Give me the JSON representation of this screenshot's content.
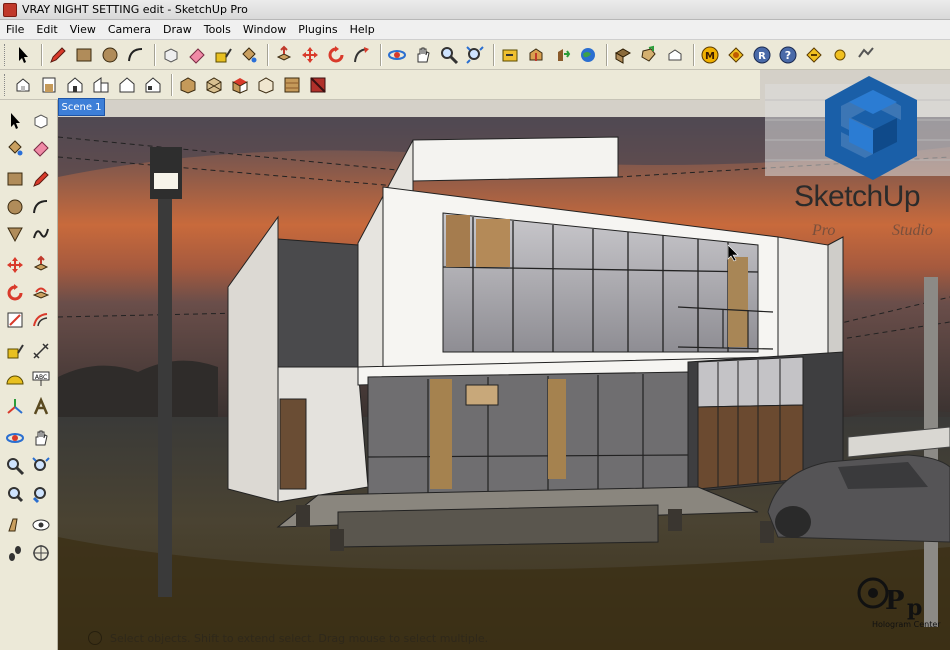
{
  "window": {
    "title": "VRAY NIGHT SETTING edit - SketchUp Pro"
  },
  "menu": {
    "items": [
      "File",
      "Edit",
      "View",
      "Camera",
      "Draw",
      "Tools",
      "Window",
      "Plugins",
      "Help"
    ]
  },
  "toolbar_main": {
    "tools": [
      "select-icon",
      "pencil-line-icon",
      "rectangle-icon",
      "circle-icon",
      "arc-icon",
      "make-component-icon",
      "eraser-icon",
      "tape-measure-icon",
      "paint-bucket-icon",
      "push-pull-icon",
      "move-icon",
      "rotate-icon",
      "follow-me-icon",
      "orbit-icon",
      "pan-icon",
      "zoom-icon",
      "zoom-extents-icon",
      "previous-view-icon",
      "get-models-icon",
      "share-model-icon",
      "google-earth-icon",
      "component-icon",
      "extension-icon",
      "warehouse-icon",
      "vray-material-icon",
      "vray-options-icon",
      "vray-render-icon",
      "vray-help-icon",
      "vray-frame-buffer-icon",
      "vray-light-icon",
      "vray-sphere-icon"
    ]
  },
  "toolbar_views": {
    "tools": [
      "iso-view-icon",
      "top-view-icon",
      "front-view-icon",
      "right-view-icon",
      "back-view-icon",
      "left-view-icon",
      "xray-style-icon",
      "wireframe-style-icon",
      "hidden-line-style-icon",
      "shaded-style-icon",
      "shaded-texture-style-icon",
      "monochrome-style-icon"
    ]
  },
  "toolbar_left": {
    "tools": [
      "select-icon",
      "make-component-icon",
      "paint-bucket-icon",
      "eraser-icon",
      "rectangle-icon",
      "line-icon",
      "circle-icon",
      "arc-icon",
      "polygon-icon",
      "freehand-icon",
      "move-icon",
      "push-pull-icon",
      "rotate-icon",
      "follow-me-icon",
      "scale-icon",
      "offset-icon",
      "tape-measure-icon",
      "dimension-icon",
      "protractor-icon",
      "text-icon",
      "axes-icon",
      "3d-text-icon",
      "orbit-icon",
      "pan-icon",
      "zoom-icon",
      "zoom-window-icon",
      "zoom-extents-icon",
      "previous-icon",
      "position-camera-icon",
      "look-around-icon",
      "walk-icon",
      "section-plane-icon"
    ]
  },
  "scene_tabs": [
    "Scene 1"
  ],
  "logo": {
    "name": "SketchUp",
    "sub_left": "Pro",
    "sub_right": "Studio",
    "colors": {
      "primary": "#1a5fa8",
      "light": "#2b7cd3"
    }
  },
  "statusbar": {
    "text": "Select objects. Shift to extend select. Drag mouse to select multiple."
  },
  "watermark": {
    "text": "Hologram Center"
  },
  "colors": {
    "sky_top": "#4a4a52",
    "sky_orange": "#c9683a",
    "ground": "#3a3325",
    "wall": "#f2f1ee",
    "glass": "#a9a9ad"
  }
}
